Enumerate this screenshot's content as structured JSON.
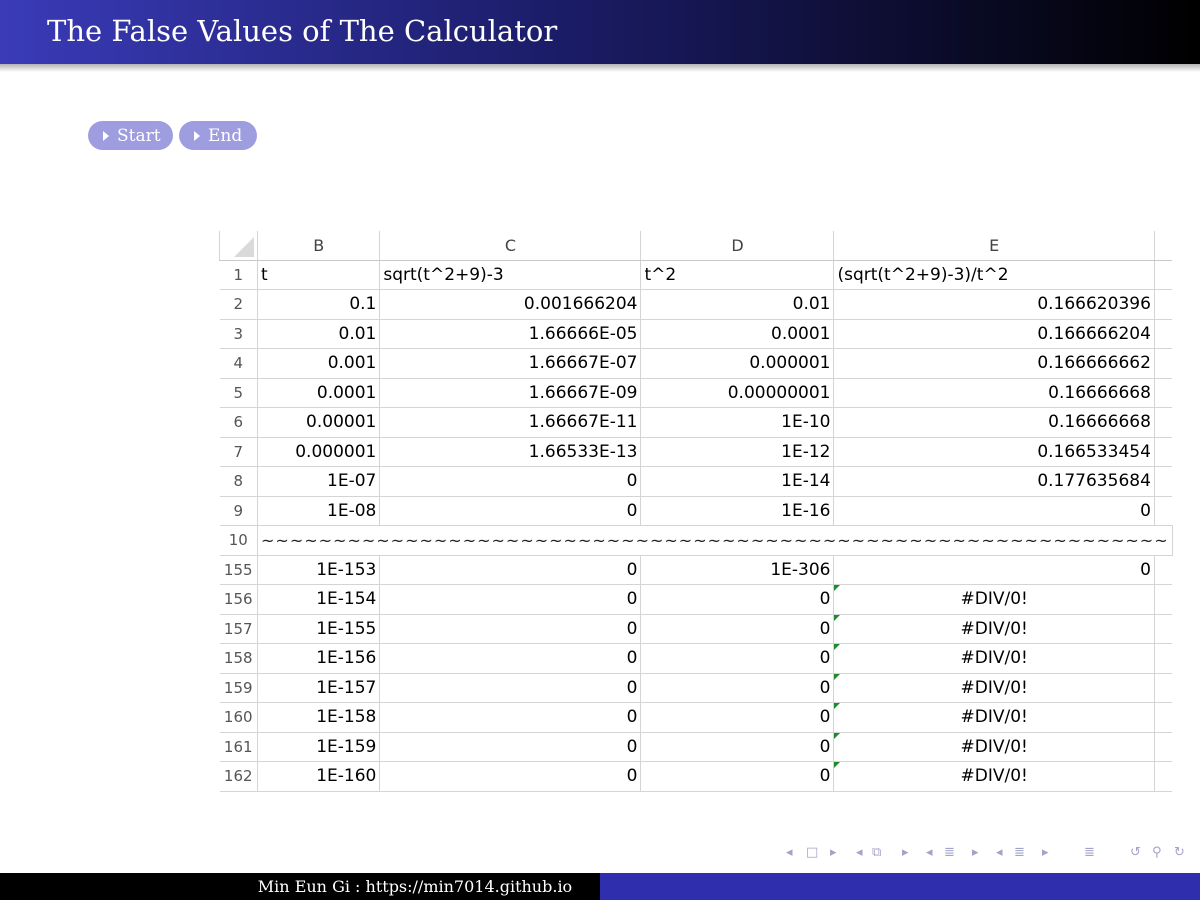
{
  "header": {
    "title": "The False Values of The Calculator"
  },
  "buttons": {
    "start": "Start",
    "end": "End"
  },
  "sheet": {
    "columns": [
      "B",
      "C",
      "D",
      "E"
    ],
    "rows": [
      {
        "n": "1",
        "b": "t",
        "c": "sqrt(t^2+9)-3",
        "d": "t^2",
        "e": "(sqrt(t^2+9)-3)/t^2"
      },
      {
        "n": "2",
        "b": "0.1",
        "c": "0.001666204",
        "d": "0.01",
        "e": "0.166620396"
      },
      {
        "n": "3",
        "b": "0.01",
        "c": "1.66666E-05",
        "d": "0.0001",
        "e": "0.166666204"
      },
      {
        "n": "4",
        "b": "0.001",
        "c": "1.66667E-07",
        "d": "0.000001",
        "e": "0.166666662"
      },
      {
        "n": "5",
        "b": "0.0001",
        "c": "1.66667E-09",
        "d": "0.00000001",
        "e": "0.16666668"
      },
      {
        "n": "6",
        "b": "0.00001",
        "c": "1.66667E-11",
        "d": "1E-10",
        "e": "0.16666668"
      },
      {
        "n": "7",
        "b": "0.000001",
        "c": "1.66533E-13",
        "d": "1E-12",
        "e": "0.166533454"
      },
      {
        "n": "8",
        "b": "1E-07",
        "c": "0",
        "d": "1E-14",
        "e": "0.177635684"
      },
      {
        "n": "9",
        "b": "1E-08",
        "c": "0",
        "d": "1E-16",
        "e": "0"
      },
      {
        "n": "10",
        "tilde": "~~~~~~~~~~~~~~~~~~~~~~~~~~~~~~~~~~~~~~~~~~~~~~~~~~~~~~~~~~~~~~~"
      },
      {
        "n": "155",
        "b": "1E-153",
        "c": "0",
        "d": "1E-306",
        "e": "0"
      },
      {
        "n": "156",
        "b": "1E-154",
        "c": "0",
        "d": "0",
        "e": "#DIV/0!"
      },
      {
        "n": "157",
        "b": "1E-155",
        "c": "0",
        "d": "0",
        "e": "#DIV/0!"
      },
      {
        "n": "158",
        "b": "1E-156",
        "c": "0",
        "d": "0",
        "e": "#DIV/0!"
      },
      {
        "n": "159",
        "b": "1E-157",
        "c": "0",
        "d": "0",
        "e": "#DIV/0!"
      },
      {
        "n": "160",
        "b": "1E-158",
        "c": "0",
        "d": "0",
        "e": "#DIV/0!"
      },
      {
        "n": "161",
        "b": "1E-159",
        "c": "0",
        "d": "0",
        "e": "#DIV/0!"
      },
      {
        "n": "162",
        "b": "1E-160",
        "c": "0",
        "d": "0",
        "e": "#DIV/0!"
      }
    ]
  },
  "nav_icons": [
    "prev-frame-icon",
    "frame-icon",
    "next-frame-icon",
    "prev-subsection-icon",
    "subsection-icon",
    "next-subsection-icon",
    "prev-section-icon",
    "section-icon",
    "next-section-icon",
    "outline-icon",
    "undo-icon",
    "search-icon",
    "redo-icon"
  ],
  "footer": {
    "text": "Min Eun Gi : https://min7014.github.io"
  },
  "colors": {
    "header_start": "#3a3bb8",
    "header_end": "#000000",
    "button": "#9d9de0",
    "footer_right": "#2f2fad"
  }
}
